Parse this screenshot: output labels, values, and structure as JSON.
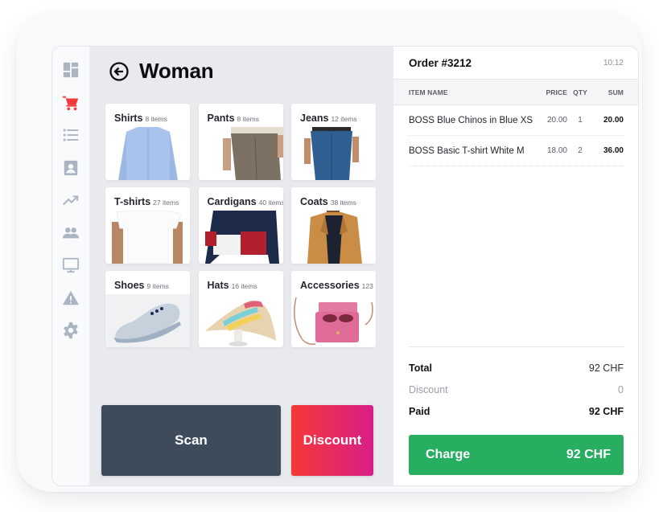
{
  "sidebar": {
    "items": [
      {
        "name": "dashboard",
        "icon": "dashboard-icon",
        "active": false
      },
      {
        "name": "cart",
        "icon": "shopping-cart-icon",
        "active": true
      },
      {
        "name": "list",
        "icon": "list-icon",
        "active": false
      },
      {
        "name": "contacts",
        "icon": "contact-card-icon",
        "active": false
      },
      {
        "name": "analytics",
        "icon": "trending-up-icon",
        "active": false
      },
      {
        "name": "customers",
        "icon": "people-icon",
        "active": false
      },
      {
        "name": "display",
        "icon": "monitor-icon",
        "active": false
      },
      {
        "name": "alerts",
        "icon": "warning-icon",
        "active": false
      },
      {
        "name": "settings",
        "icon": "gear-icon",
        "active": false
      }
    ],
    "active_color": "#f53838",
    "icon_color": "#aab4c3"
  },
  "catalog": {
    "title": "Woman",
    "back_icon": "arrow-left-circle-icon",
    "categories": [
      {
        "name": "Shirts",
        "count": "8 items",
        "image": "shirt-image"
      },
      {
        "name": "Pants",
        "count": "8 items",
        "image": "pants-image"
      },
      {
        "name": "Jeans",
        "count": "12 items",
        "image": "jeans-image"
      },
      {
        "name": "T-shirts",
        "count": "27 items",
        "image": "tshirt-image"
      },
      {
        "name": "Cardigans",
        "count": "40 items",
        "image": "cardigan-image"
      },
      {
        "name": "Coats",
        "count": "38 items",
        "image": "coat-image"
      },
      {
        "name": "Shoes",
        "count": "9 items",
        "image": "shoe-image"
      },
      {
        "name": "Hats",
        "count": "16 items",
        "image": "hat-image"
      },
      {
        "name": "Accessories",
        "count": "123",
        "image": "bag-image"
      }
    ],
    "scan_label": "Scan",
    "discount_label": "Discount"
  },
  "order": {
    "title": "Order #3212",
    "time": "10:12",
    "columns": {
      "name": "ITEM NAME",
      "price": "PRICE",
      "qty": "QTY",
      "sum": "SUM"
    },
    "items": [
      {
        "name": "BOSS Blue Chinos in Blue XS",
        "price": "20.00",
        "qty": "1",
        "sum": "20.00"
      },
      {
        "name": "BOSS Basic T-shirt White M",
        "price": "18.00",
        "qty": "2",
        "sum": "36.00"
      }
    ],
    "totals": {
      "total_label": "Total",
      "total_value": "92 CHF",
      "discount_label": "Discount",
      "discount_value": "0",
      "paid_label": "Paid",
      "paid_value": "92 CHF"
    },
    "charge_label": "Charge",
    "charge_amount": "92 CHF",
    "charge_color": "#27ae60"
  }
}
